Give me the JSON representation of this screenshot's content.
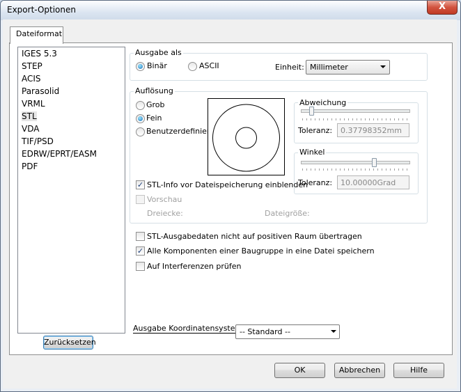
{
  "window": {
    "title": "Export-Optionen",
    "close_glyph": "X"
  },
  "tab": {
    "label": "Dateiformat"
  },
  "formats": [
    "IGES 5.3",
    "STEP",
    "ACIS",
    "Parasolid",
    "VRML",
    "STL",
    "VDA",
    "TIF/PSD",
    "EDRW/EPRT/EASM",
    "PDF"
  ],
  "selected_format": "STL",
  "reset_button": "Zurücksetzen",
  "output": {
    "legend": "Ausgabe als",
    "binary": "Binär",
    "ascii": "ASCII",
    "unit_label": "Einheit:",
    "unit_value": "Millimeter",
    "selected": "Binär"
  },
  "resolution": {
    "legend": "Auflösung",
    "options": [
      "Grob",
      "Fein",
      "Benutzerdefiniert"
    ],
    "selected": "Fein",
    "deviation": {
      "legend": "Abweichung",
      "tol_label": "Toleranz:",
      "tol_value": "0.37798352mm",
      "slider_level": 0.08
    },
    "angle": {
      "legend": "Winkel",
      "tol_label": "Toleranz:",
      "tol_value": "10.00000Grad",
      "slider_level": 0.68
    },
    "stl_info": {
      "label": "STL-Info vor Dateispeicherung einblenden",
      "checked": true
    },
    "preview": {
      "label": "Vorschau",
      "checked": false,
      "enabled": false
    },
    "triangles_label": "Dreiecke:",
    "filesize_label": "Dateigröße:"
  },
  "options": [
    {
      "label": "STL-Ausgabedaten nicht auf positiven Raum übertragen",
      "checked": false
    },
    {
      "label": "Alle Komponenten einer Baugruppe in eine Datei speichern",
      "checked": true
    },
    {
      "label": "Auf Interferenzen prüfen",
      "checked": false
    }
  ],
  "coord": {
    "label": "Ausgabe Koordinatensystem:",
    "value": "-- Standard --"
  },
  "buttons": {
    "ok": "OK",
    "cancel": "Abbrechen",
    "help": "Hilfe"
  },
  "check_glyph": "✓"
}
